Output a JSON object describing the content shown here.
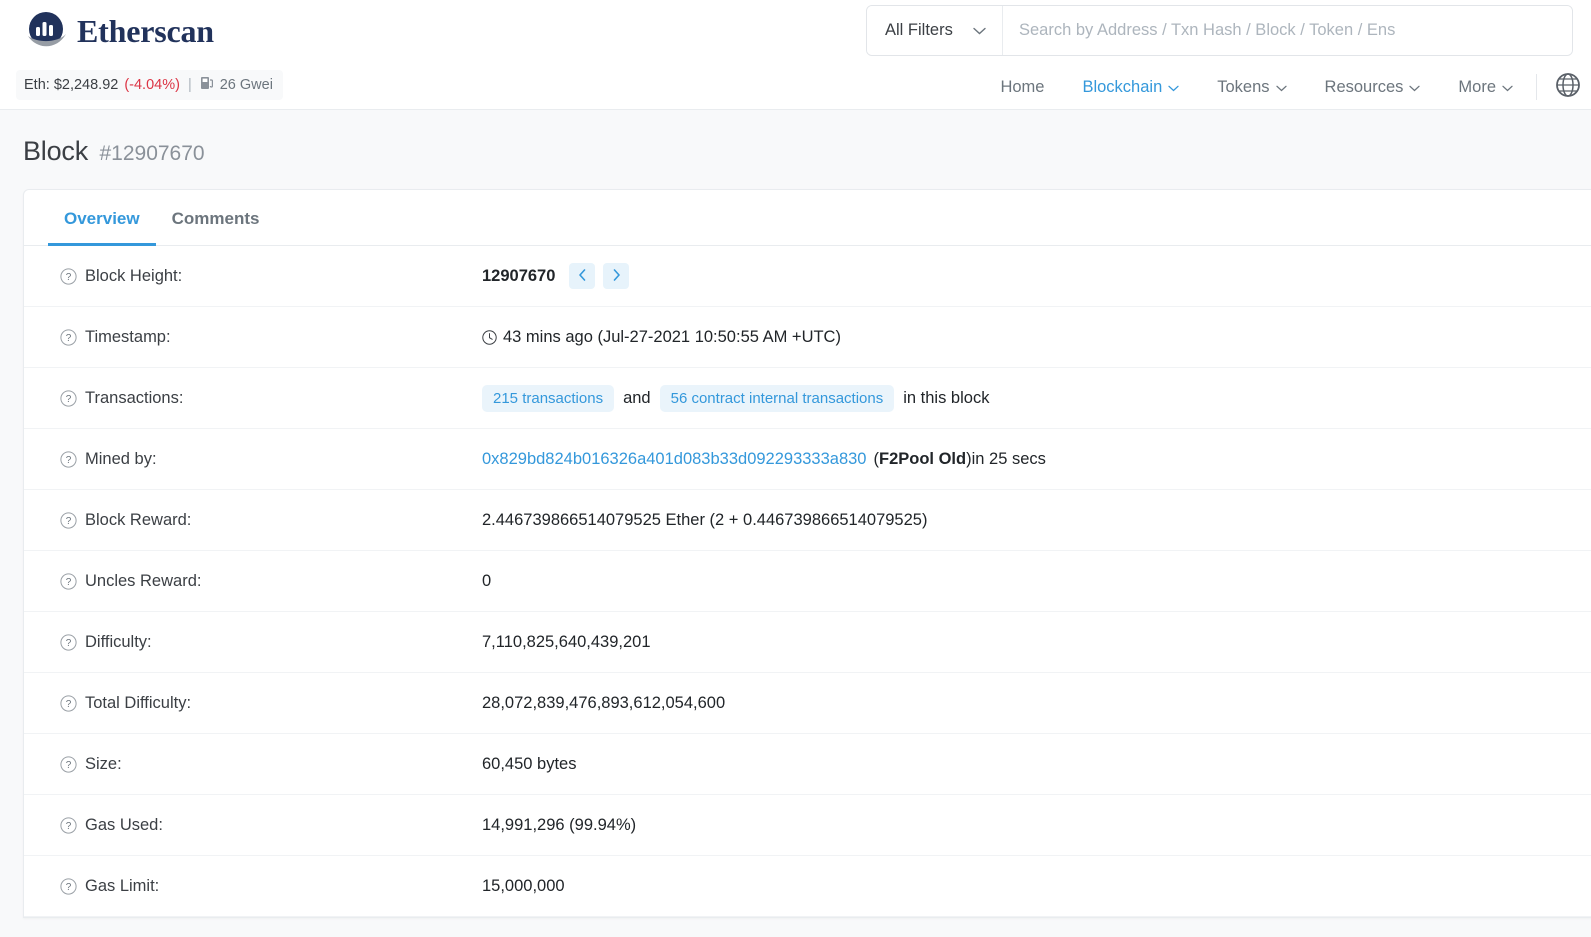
{
  "brand": {
    "name": "Etherscan",
    "logo_icon": "etherscan-logo-icon"
  },
  "price_bar": {
    "eth_label": "Eth: $2,248.92",
    "change": "(-4.04%)",
    "separator": "|",
    "gas_icon": "gas-pump-icon",
    "gas": "26 Gwei"
  },
  "search": {
    "filter_label": "All Filters",
    "filter_chevron_icon": "chevron-down-icon",
    "placeholder": "Search by Address / Txn Hash / Block / Token / Ens",
    "value": ""
  },
  "nav": {
    "items": [
      {
        "label": "Home",
        "has_caret": false,
        "active": false
      },
      {
        "label": "Blockchain",
        "has_caret": true,
        "active": true
      },
      {
        "label": "Tokens",
        "has_caret": true,
        "active": false
      },
      {
        "label": "Resources",
        "has_caret": true,
        "active": false
      },
      {
        "label": "More",
        "has_caret": true,
        "active": false
      }
    ],
    "globe_icon": "globe-language-icon"
  },
  "page": {
    "title": "Block",
    "subtitle": "#12907670"
  },
  "tabs": [
    {
      "label": "Overview",
      "active": true
    },
    {
      "label": "Comments",
      "active": false
    }
  ],
  "overview": {
    "block_height": {
      "label": "Block Height:",
      "value": "12907670",
      "prev_icon": "chevron-left-icon",
      "next_icon": "chevron-right-icon"
    },
    "timestamp": {
      "label": "Timestamp:",
      "icon": "clock-icon",
      "value": "43 mins ago (Jul-27-2021 10:50:55 AM +UTC)"
    },
    "transactions": {
      "label": "Transactions:",
      "txn_badge": "215 transactions",
      "conjunction": "and",
      "internal_badge": "56 contract internal transactions",
      "tail": "in this block"
    },
    "mined_by": {
      "label": "Mined by:",
      "address": "0x829bd824b016326a401d083b33d092293333a830",
      "open_paren": "(",
      "miner_name": "F2Pool Old",
      "close_paren": ")",
      "duration": " in 25 secs"
    },
    "block_reward": {
      "label": "Block Reward:",
      "value": "2.446739866514079525 Ether (2 + 0.446739866514079525)"
    },
    "uncles_reward": {
      "label": "Uncles Reward:",
      "value": "0"
    },
    "difficulty": {
      "label": "Difficulty:",
      "value": "7,110,825,640,439,201"
    },
    "total_difficulty": {
      "label": "Total Difficulty:",
      "value": "28,072,839,476,893,612,054,600"
    },
    "size": {
      "label": "Size:",
      "value": "60,450 bytes"
    },
    "gas_used": {
      "label": "Gas Used:",
      "value": "14,991,296 (99.94%)"
    },
    "gas_limit": {
      "label": "Gas Limit:",
      "value": "15,000,000"
    }
  },
  "colors": {
    "accent": "#3498db",
    "brand": "#21325b",
    "negative": "#dc3545",
    "badge_bg": "#eaf4fb",
    "page_bg": "#f8f9fa"
  }
}
